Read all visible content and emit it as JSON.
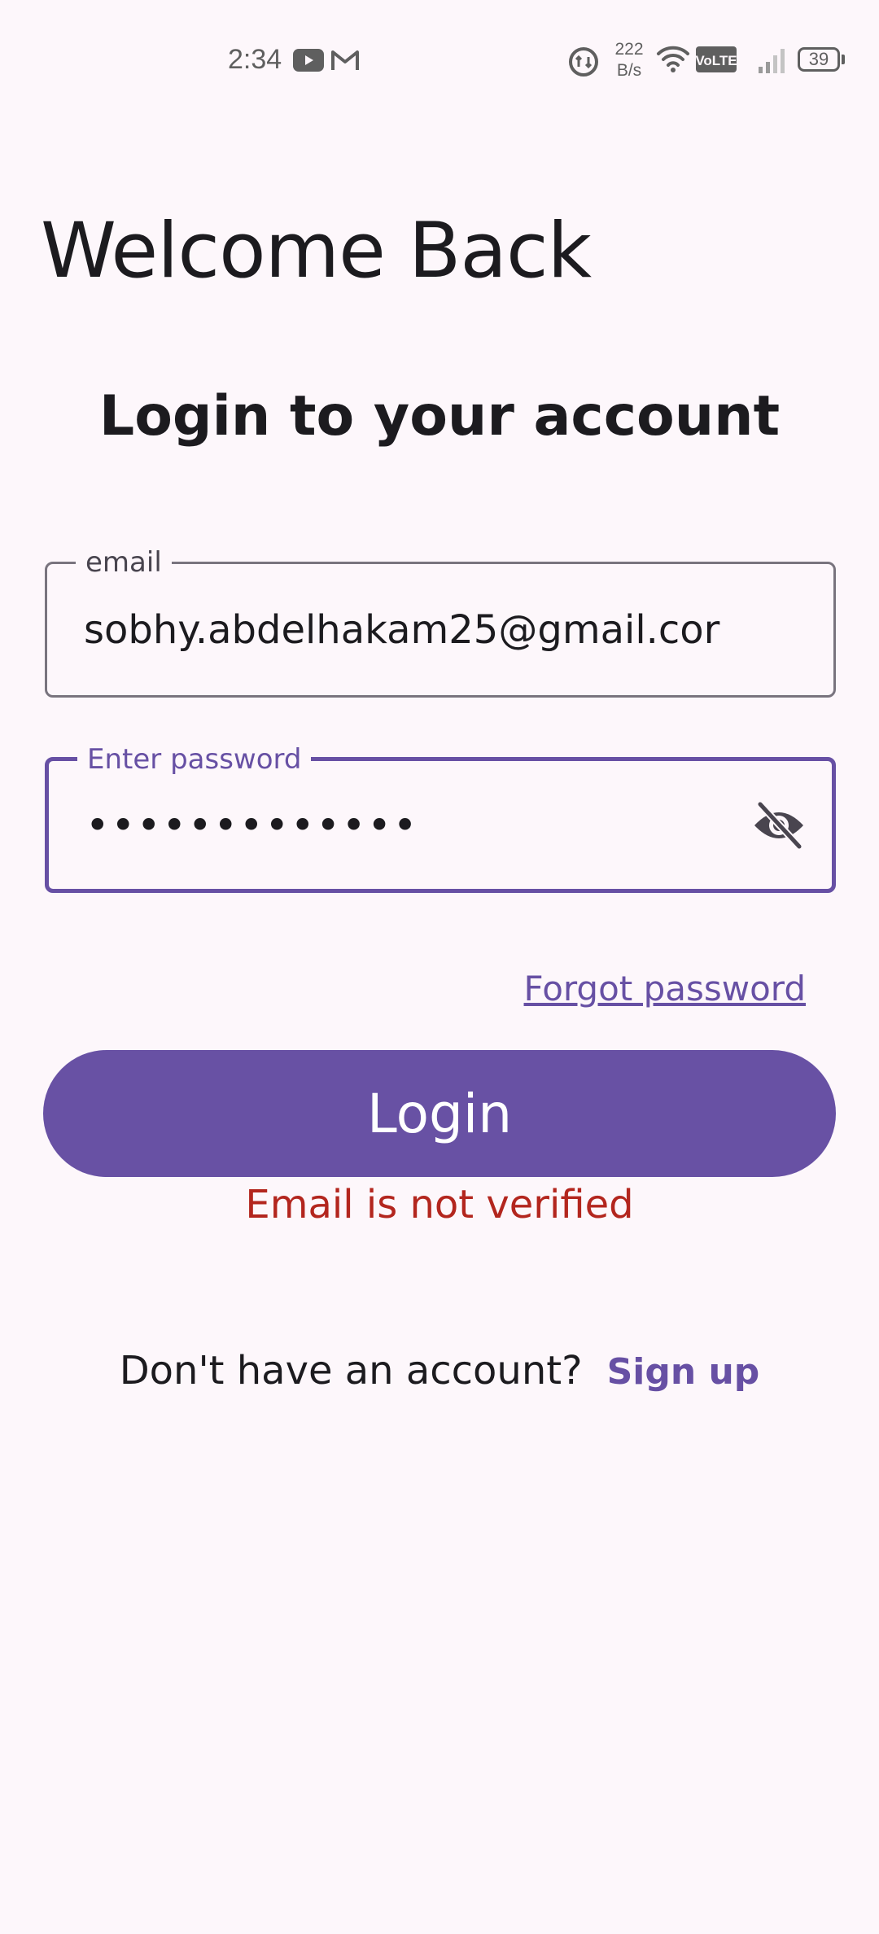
{
  "status_bar": {
    "time": "2:34",
    "net_speed_value": "222",
    "net_speed_unit": "B/s",
    "volte_label": "VoLTE",
    "battery_level": "39",
    "icons": [
      "youtube-icon",
      "gmail-icon",
      "data-saver-icon",
      "wifi-icon",
      "volte-icon",
      "signal-icon",
      "battery-icon"
    ]
  },
  "header": {
    "title": "Welcome Back",
    "subtitle": "Login to your account"
  },
  "form": {
    "email": {
      "label": "email",
      "value": "sobhy.abdelhakam25@gmail.cor"
    },
    "password": {
      "label": "Enter password",
      "value": "•••••••••••••",
      "toggle_icon": "visibility-off-icon"
    },
    "forgot_password": "Forgot password",
    "login_button": "Login",
    "error_message": "Email is not verified"
  },
  "footer": {
    "prompt": "Don't have an account?",
    "signup_link": "Sign up"
  },
  "colors": {
    "background": "#fdf7fb",
    "primary": "#6750a4",
    "button": "#6851a4",
    "error": "#b3261e",
    "outline": "#79747e"
  }
}
